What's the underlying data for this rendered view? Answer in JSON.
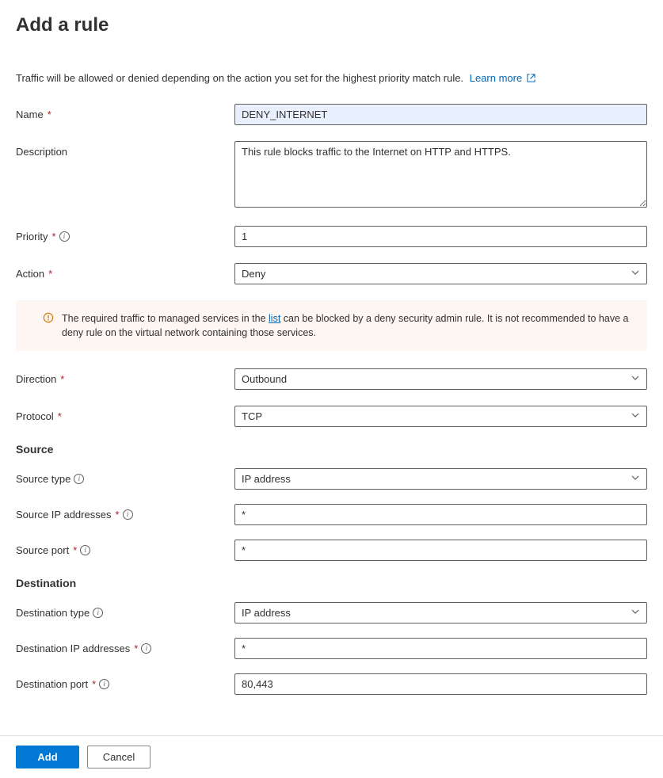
{
  "title": "Add a rule",
  "intro_text": "Traffic will be allowed or denied depending on the action you set for the highest priority match rule.",
  "learn_more": "Learn more",
  "fields": {
    "name": {
      "label": "Name",
      "value": "DENY_INTERNET"
    },
    "description": {
      "label": "Description",
      "value": "This rule blocks traffic to the Internet on HTTP and HTTPS."
    },
    "priority": {
      "label": "Priority",
      "value": "1"
    },
    "action": {
      "label": "Action",
      "value": "Deny"
    },
    "direction": {
      "label": "Direction",
      "value": "Outbound"
    },
    "protocol": {
      "label": "Protocol",
      "value": "TCP"
    },
    "source_type": {
      "label": "Source type",
      "value": "IP address"
    },
    "source_ip": {
      "label": "Source IP addresses",
      "value": "*"
    },
    "source_port": {
      "label": "Source port",
      "value": "*"
    },
    "dest_type": {
      "label": "Destination type",
      "value": "IP address"
    },
    "dest_ip": {
      "label": "Destination IP addresses",
      "value": "*"
    },
    "dest_port": {
      "label": "Destination port",
      "value": "80,443"
    }
  },
  "warning": {
    "pre": "The required traffic to managed services in the ",
    "link": "list",
    "post": " can be blocked by a deny security admin rule. It is not recommended to have a deny rule on the virtual network containing those services."
  },
  "sections": {
    "source": "Source",
    "destination": "Destination"
  },
  "buttons": {
    "add": "Add",
    "cancel": "Cancel"
  }
}
